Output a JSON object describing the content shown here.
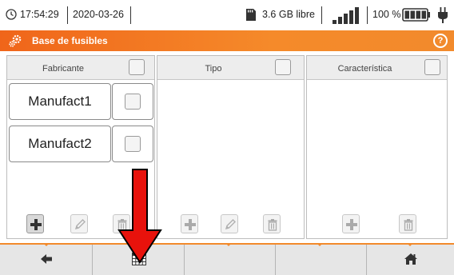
{
  "statusbar": {
    "time": "17:54:29",
    "date": "2020-03-26",
    "storage_free": "3.6 GB libre",
    "battery_percent": "100 %",
    "icons": [
      "clock-icon",
      "sd-card-icon",
      "signal-icon",
      "battery-icon",
      "plug-icon"
    ]
  },
  "titlebar": {
    "title": "Base de fusibles",
    "help_label": "?",
    "icons": [
      "settings-gears-icon",
      "help-icon"
    ]
  },
  "panels": {
    "manufacturer": {
      "header": "Fabricante",
      "items": [
        {
          "label": "Manufact1"
        },
        {
          "label": "Manufact2"
        }
      ]
    },
    "type": {
      "header": "Tipo",
      "items": []
    },
    "characteristic": {
      "header": "Característica",
      "items": []
    }
  },
  "toolbar_icons": [
    "add-icon",
    "edit-icon",
    "delete-icon"
  ],
  "bottomnav": {
    "icons": [
      "back-arrow-icon",
      "table-icon",
      "home-icon"
    ]
  },
  "colors": {
    "accent_orange": "#f28a2c",
    "arrow_red": "#e8120c"
  }
}
